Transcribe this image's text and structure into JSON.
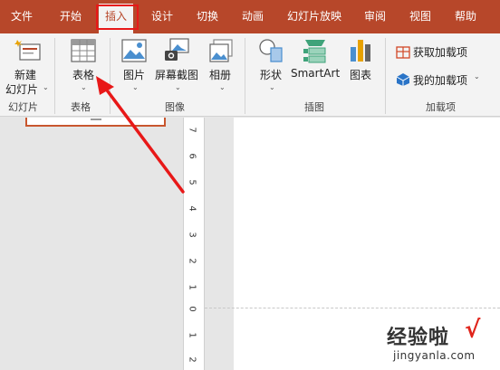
{
  "tabs": [
    "文件",
    "开始",
    "插入",
    "设计",
    "切换",
    "动画",
    "幻灯片放映",
    "审阅",
    "视图",
    "帮助"
  ],
  "active_tab": "插入",
  "ribbon": {
    "slides": {
      "new_slide_line1": "新建",
      "new_slide_line2": "幻灯片",
      "group": "幻灯片"
    },
    "tables": {
      "table": "表格",
      "group": "表格"
    },
    "images": {
      "picture": "图片",
      "screenshot": "屏幕截图",
      "album": "相册",
      "group": "图像"
    },
    "illustrations": {
      "shapes": "形状",
      "smartart": "SmartArt",
      "chart": "图表",
      "group": "插图"
    },
    "addins": {
      "get_addins": "获取加载项",
      "my_addins": "我的加载项",
      "group": "加载项"
    }
  },
  "ruler_numbers": [
    "7",
    "6",
    "5",
    "4",
    "3",
    "2",
    "1",
    "0",
    "1",
    "2"
  ],
  "watermark": {
    "main": "经验啦",
    "check": "√",
    "url": "jingyanla.com"
  },
  "colors": {
    "accent": "#b7472a",
    "highlight": "#e81818",
    "arrow": "#e81818"
  }
}
